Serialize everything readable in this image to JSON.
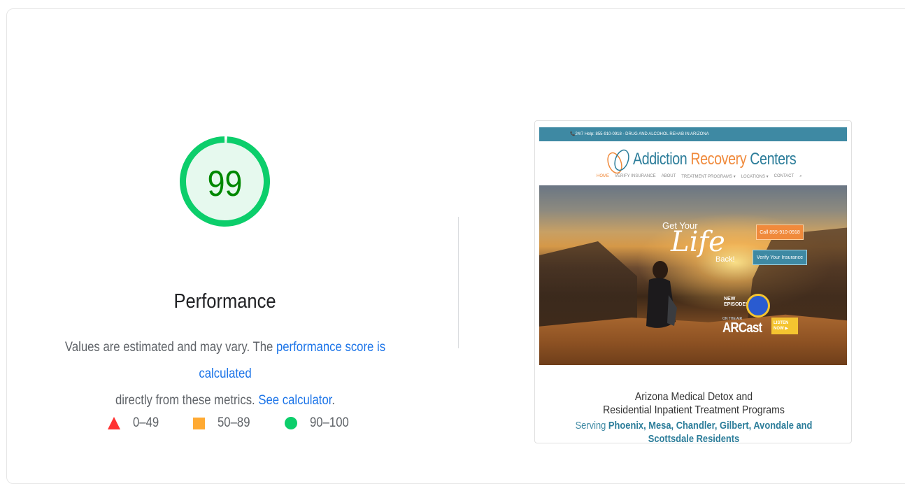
{
  "gauge": {
    "score": "99",
    "score_value": 99,
    "title": "Performance",
    "ring_color": "#0cce6b",
    "fill_color": "#e6f9ee",
    "text_color": "#008800"
  },
  "description": {
    "prefix": "Values are estimated and may vary. The ",
    "link1": "performance score is calculated",
    "middle": " directly from these metrics. ",
    "link2": "See calculator",
    "suffix": "."
  },
  "legend": [
    {
      "label": "0–49",
      "icon": "red-triangle-icon",
      "color": "#ff3333"
    },
    {
      "label": "50–89",
      "icon": "orange-square-icon",
      "color": "#ffaa33"
    },
    {
      "label": "90–100",
      "icon": "green-circle-icon",
      "color": "#0cce6b"
    }
  ],
  "screenshot": {
    "topbar": "📞24/7 Help: 855-910-0918 - DRUG AND ALCOHOL REHAB IN ARIZONA",
    "logo_part1": "Addiction ",
    "logo_part2": "Recovery",
    "logo_part3": " Centers",
    "nav": [
      "HOME",
      "VERIFY INSURANCE",
      "ABOUT",
      "TREATMENT PROGRAMS ▾",
      "LOCATIONS ▾",
      "CONTACT",
      "⌕"
    ],
    "hero_get_your": "Get Your",
    "hero_life": "Life",
    "hero_back": "Back!",
    "hero_call": "Call 855-910-0918",
    "hero_verify": "Verify Your Insurance",
    "arcast_new": "NEW EPISODES",
    "arcast_onair": "ON THE AIR",
    "arcast_name": "ARCast",
    "arcast_listen": "LISTEN NOW ▶",
    "heading1": "Arizona Medical Detox and",
    "heading2": "Residential Inpatient Treatment Programs",
    "serving_prefix": "Serving ",
    "serving_cities": "Phoenix, Mesa, Chandler, Gilbert, Avondale and",
    "serving_line2": "Scottsdale Residents"
  }
}
